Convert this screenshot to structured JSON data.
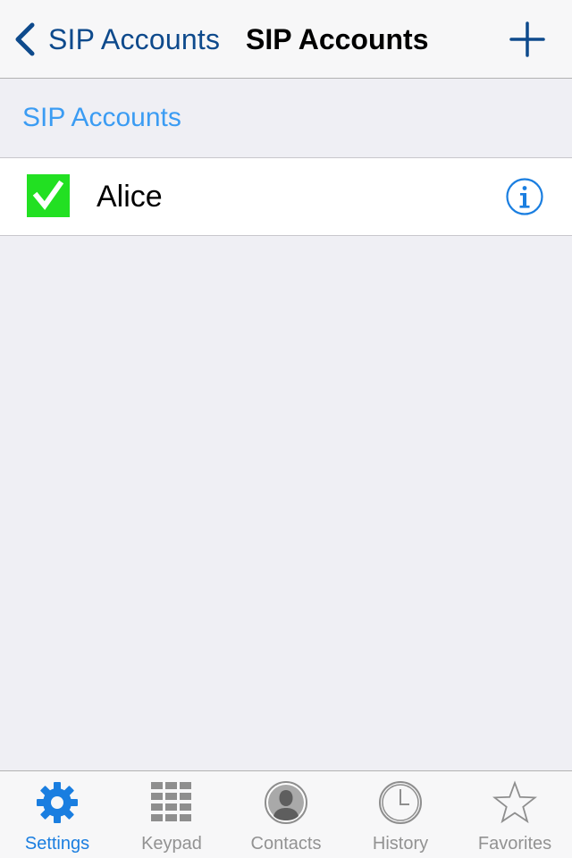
{
  "nav": {
    "back_label": "SIP Accounts",
    "title": "SIP Accounts",
    "back_icon": "chevron-left-icon",
    "add_icon": "plus-icon"
  },
  "section": {
    "header": "SIP Accounts"
  },
  "accounts": [
    {
      "name": "Alice",
      "status_icon": "checkmark-icon",
      "status_color": "#22e022",
      "info_icon": "info-icon"
    }
  ],
  "tabs": [
    {
      "label": "Settings",
      "icon": "gear-icon",
      "active": true
    },
    {
      "label": "Keypad",
      "icon": "keypad-icon",
      "active": false
    },
    {
      "label": "Contacts",
      "icon": "person-icon",
      "active": false
    },
    {
      "label": "History",
      "icon": "clock-icon",
      "active": false
    },
    {
      "label": "Favorites",
      "icon": "star-icon",
      "active": false
    }
  ],
  "colors": {
    "accent": "#1a7ee0",
    "section_header": "#3b9cf3",
    "nav_tint": "#0e4a8c",
    "inactive_tab": "#929292",
    "background": "#efeff4"
  }
}
